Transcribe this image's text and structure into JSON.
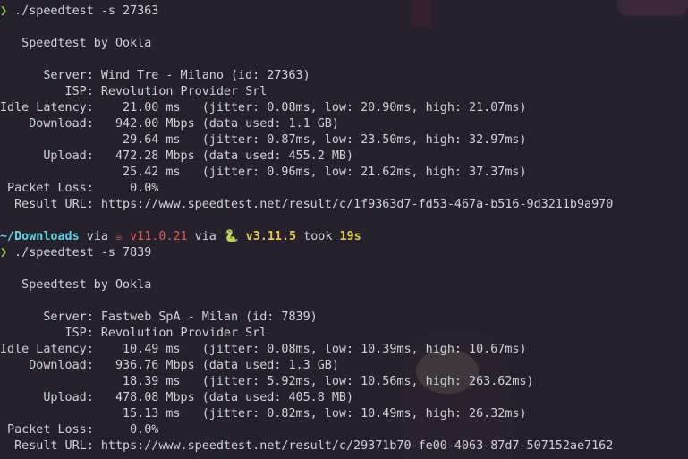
{
  "colors": {
    "prompt_arrow": "#8fd14f",
    "directory": "#5fd7e0",
    "java_version": "#e05a55",
    "python_version": "#e6c84f",
    "duration": "#e6c84f",
    "text": "#d4d2d8",
    "background": "#221e2a"
  },
  "run1": {
    "prompt_symbol": "❯",
    "command": " ./speedtest -s 27363",
    "title": "   Speedtest by Ookla",
    "server": "      Server: Wind Tre - Milano (id: 27363)",
    "isp": "         ISP: Revolution Provider Srl",
    "idle_latency": "Idle Latency:    21.00 ms   (jitter: 0.08ms, low: 20.90ms, high: 21.07ms)",
    "download": "    Download:   942.00 Mbps (data used: 1.1 GB)",
    "download_latency": "                 29.64 ms   (jitter: 0.87ms, low: 23.50ms, high: 32.97ms)",
    "upload": "      Upload:   472.28 Mbps (data used: 455.2 MB)",
    "upload_latency": "                 25.42 ms   (jitter: 0.96ms, low: 21.62ms, high: 37.37ms)",
    "packet_loss": " Packet Loss:     0.0%",
    "result_url": "  Result URL: https://www.speedtest.net/result/c/1f9363d7-fd53-467a-b516-9d3211b9a970"
  },
  "prompt2": {
    "directory": "~/Downloads",
    "via1": " via ",
    "java_icon": "java-cup-icon",
    "java_glyph": "☕",
    "java_version": " v11.0.21",
    "via2": " via ",
    "python_icon": "python-snake-icon",
    "python_glyph": "🐍",
    "python_version": " v3.11.5",
    "took": " took ",
    "duration": "19s"
  },
  "run2": {
    "prompt_symbol": "❯",
    "command": " ./speedtest -s 7839",
    "title": "   Speedtest by Ookla",
    "server": "      Server: Fastweb SpA - Milan (id: 7839)",
    "isp": "         ISP: Revolution Provider Srl",
    "idle_latency": "Idle Latency:    10.49 ms   (jitter: 0.08ms, low: 10.39ms, high: 10.67ms)",
    "download": "    Download:   936.76 Mbps (data used: 1.3 GB)",
    "download_latency": "                 18.39 ms   (jitter: 5.92ms, low: 10.56ms, high: 263.62ms)",
    "upload": "      Upload:   478.08 Mbps (data used: 405.8 MB)",
    "upload_latency": "                 15.13 ms   (jitter: 0.82ms, low: 10.49ms, high: 26.32ms)",
    "packet_loss": " Packet Loss:     0.0%",
    "result_url": "  Result URL: https://www.speedtest.net/result/c/29371b70-fe00-4063-87d7-507152ae7162"
  }
}
